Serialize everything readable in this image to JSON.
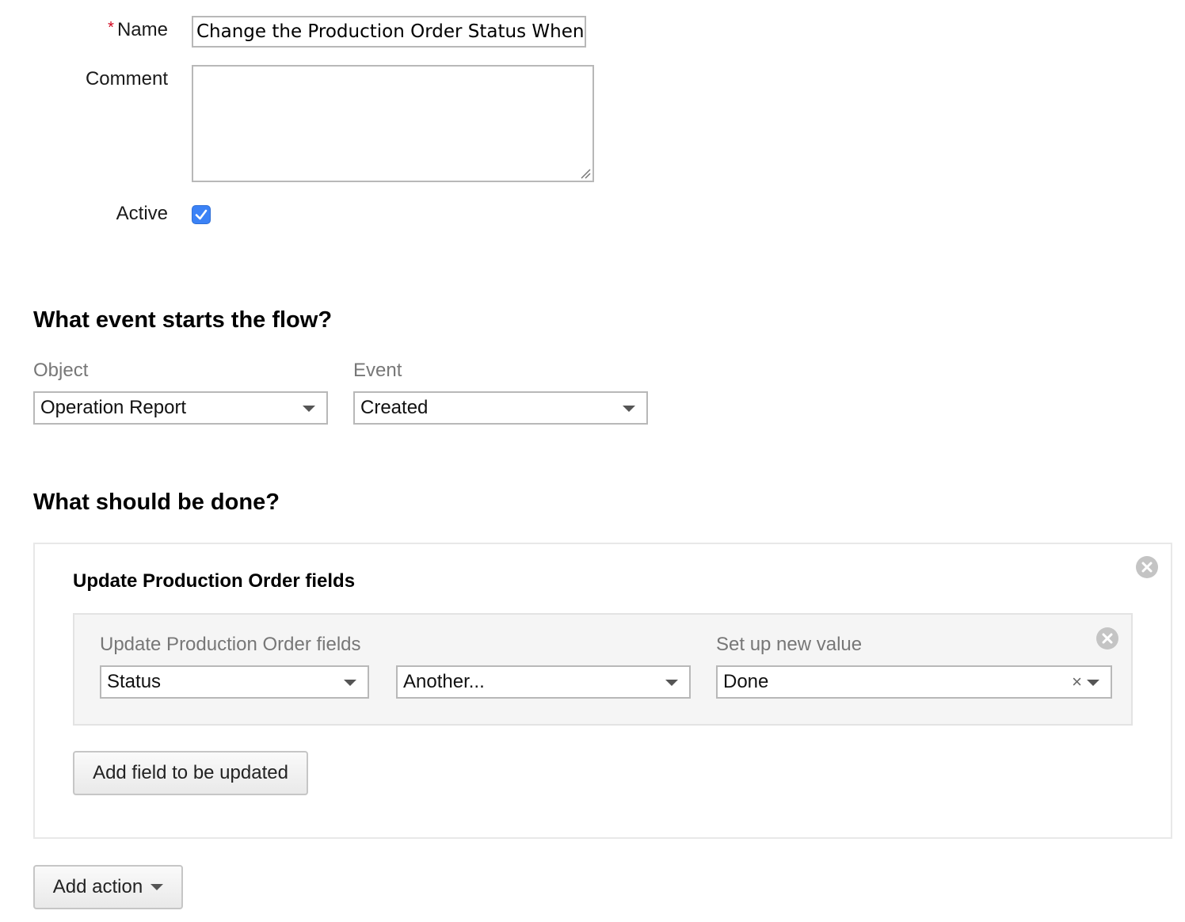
{
  "form": {
    "name_label": "Name",
    "required_marker": "*",
    "name_value": "Change the Production Order Status When a",
    "comment_label": "Comment",
    "comment_value": "",
    "active_label": "Active",
    "active_checked": true
  },
  "trigger": {
    "heading": "What event starts the flow?",
    "object_label": "Object",
    "object_value": "Operation Report",
    "event_label": "Event",
    "event_value": "Created"
  },
  "actions": {
    "heading": "What should be done?",
    "action_title": "Update Production Order fields",
    "row": {
      "fields_label": "Update Production Order fields",
      "field_value": "Status",
      "mode_value": "Another...",
      "new_value_label": "Set up new value",
      "new_value": "Done",
      "clear_icon": "×"
    },
    "add_field_button": "Add field to be updated",
    "add_action_button": "Add action"
  },
  "colors": {
    "checkbox_accent": "#3b82f6",
    "required_star": "#d0021b",
    "muted_label": "#777777"
  }
}
